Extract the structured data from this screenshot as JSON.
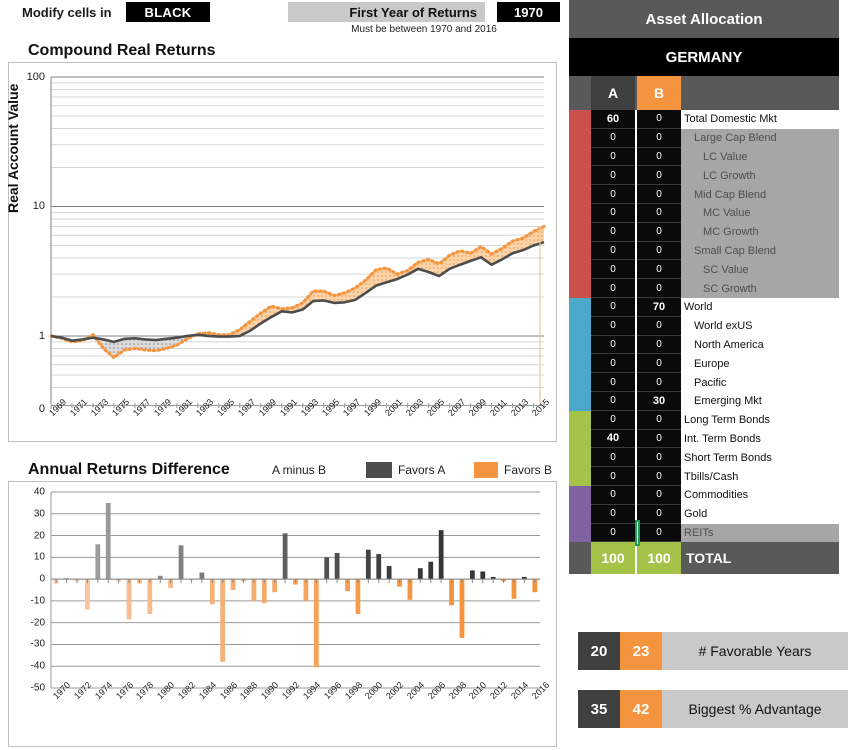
{
  "controls": {
    "modify_label": "Modify cells in",
    "modify_chip": "BLACK",
    "first_year_label": "First Year of Returns",
    "first_year_value": "1970",
    "note": "Must be between 1970 and 2016"
  },
  "charts": {
    "top": {
      "title": "Compound Real Returns",
      "ylabel": "Real Account Value"
    },
    "bottom": {
      "title": "Annual Returns Difference",
      "legend": {
        "series_label": "A minus B",
        "favors_a": "Favors A",
        "favors_b": "Favors B",
        "color_a": "#4d4d4d",
        "color_b": "#f5943e"
      }
    }
  },
  "chart_data": [
    {
      "type": "line",
      "title": "Compound Real Returns",
      "xlabel": "",
      "ylabel": "Real Account Value",
      "yscale": "log",
      "ylim": [
        0.35,
        100
      ],
      "yticks": [
        0,
        1,
        10,
        100
      ],
      "ytick_labels": [
        "0",
        "1",
        "10",
        "100"
      ],
      "grid": true,
      "legend_position": "none",
      "x": [
        1969,
        1970,
        1971,
        1972,
        1973,
        1974,
        1975,
        1976,
        1977,
        1978,
        1979,
        1980,
        1981,
        1982,
        1983,
        1984,
        1985,
        1986,
        1987,
        1988,
        1989,
        1990,
        1991,
        1992,
        1993,
        1994,
        1995,
        1996,
        1997,
        1998,
        1999,
        2000,
        2001,
        2002,
        2003,
        2004,
        2005,
        2006,
        2007,
        2008,
        2009,
        2010,
        2011,
        2012,
        2013,
        2014,
        2015,
        2016
      ],
      "series": [
        {
          "name": "A",
          "color": "#4d4d4d",
          "style": "solid",
          "values": [
            1.0,
            0.97,
            0.92,
            0.94,
            0.97,
            0.94,
            0.9,
            0.95,
            0.96,
            0.94,
            0.93,
            0.95,
            0.97,
            1.0,
            1.02,
            1.0,
            0.99,
            0.99,
            1.0,
            1.1,
            1.25,
            1.4,
            1.55,
            1.52,
            1.6,
            1.86,
            1.88,
            1.8,
            1.82,
            1.9,
            2.15,
            2.45,
            2.6,
            2.75,
            2.98,
            3.3,
            3.12,
            2.9,
            3.3,
            3.55,
            3.8,
            4.05,
            3.55,
            3.9,
            4.35,
            4.6,
            5.0,
            5.3
          ]
        },
        {
          "name": "B",
          "color": "#f5943e",
          "style": "dotted",
          "values": [
            1.0,
            0.96,
            0.9,
            0.92,
            1.02,
            0.8,
            0.68,
            0.78,
            0.8,
            0.78,
            0.77,
            0.8,
            0.85,
            0.95,
            1.04,
            1.06,
            1.02,
            1.02,
            1.12,
            1.3,
            1.5,
            1.7,
            1.62,
            1.65,
            1.8,
            2.22,
            2.22,
            2.05,
            2.15,
            2.35,
            2.7,
            3.25,
            3.35,
            3.0,
            3.2,
            3.7,
            3.9,
            3.6,
            4.2,
            4.55,
            4.35,
            4.9,
            4.3,
            4.75,
            5.4,
            5.7,
            6.4,
            7.0
          ]
        }
      ],
      "xticks": [
        1969,
        1971,
        1973,
        1975,
        1977,
        1979,
        1981,
        1983,
        1985,
        1987,
        1989,
        1991,
        1993,
        1995,
        1997,
        1999,
        2001,
        2003,
        2005,
        2007,
        2009,
        2011,
        2013,
        2015
      ]
    },
    {
      "type": "bar",
      "title": "Annual Returns Difference",
      "xlabel": "",
      "ylabel": "",
      "ylim": [
        -50,
        40
      ],
      "yticks": [
        40,
        30,
        20,
        10,
        0,
        -10,
        -20,
        -30,
        -40,
        -50
      ],
      "grid": true,
      "legend_position": "top-right",
      "series_name": "A minus B",
      "categories": [
        1970,
        1971,
        1972,
        1973,
        1974,
        1975,
        1976,
        1977,
        1978,
        1979,
        1980,
        1981,
        1982,
        1983,
        1984,
        1985,
        1986,
        1987,
        1988,
        1989,
        1990,
        1991,
        1992,
        1993,
        1994,
        1995,
        1996,
        1997,
        1998,
        1999,
        2000,
        2001,
        2002,
        2003,
        2004,
        2005,
        2006,
        2007,
        2008,
        2009,
        2010,
        2011,
        2012,
        2013,
        2014,
        2015,
        2016
      ],
      "values": [
        -2,
        0.5,
        -1,
        -14,
        16,
        35,
        -1,
        -18.5,
        -2,
        -16,
        1.5,
        -4,
        15.5,
        -0.5,
        3,
        -11.5,
        -38,
        -5,
        -1,
        -10,
        -11,
        -6,
        21,
        -2.5,
        -10,
        -40.5,
        10,
        12,
        -5.5,
        -16,
        13.5,
        11.5,
        6,
        -3.5,
        -9.5,
        5,
        8,
        22.5,
        -12,
        -27,
        4,
        3.5,
        1,
        -1,
        -9,
        1,
        -6
      ],
      "xticks": [
        1970,
        1972,
        1974,
        1976,
        1978,
        1980,
        1982,
        1984,
        1986,
        1988,
        1990,
        1992,
        1994,
        1996,
        1998,
        2000,
        2002,
        2004,
        2006,
        2008,
        2010,
        2012,
        2014,
        2016
      ]
    }
  ],
  "allocation": {
    "title": "Asset Allocation",
    "country": "GERMANY",
    "col_a": "A",
    "col_b": "B",
    "rows": [
      {
        "a": "60",
        "b": "0",
        "label": "Total Domestic Mkt",
        "indent": 0,
        "shade": "white",
        "strip": "#c9504d"
      },
      {
        "a": "0",
        "b": "0",
        "label": "Large Cap Blend",
        "indent": 1,
        "shade": "shade",
        "strip": "#c9504d"
      },
      {
        "a": "0",
        "b": "0",
        "label": "LC Value",
        "indent": 2,
        "shade": "shade",
        "strip": "#c9504d"
      },
      {
        "a": "0",
        "b": "0",
        "label": "LC Growth",
        "indent": 2,
        "shade": "shade",
        "strip": "#c9504d"
      },
      {
        "a": "0",
        "b": "0",
        "label": "Mid Cap Blend",
        "indent": 1,
        "shade": "shade",
        "strip": "#c9504d"
      },
      {
        "a": "0",
        "b": "0",
        "label": "MC Value",
        "indent": 2,
        "shade": "shade",
        "strip": "#c9504d"
      },
      {
        "a": "0",
        "b": "0",
        "label": "MC Growth",
        "indent": 2,
        "shade": "shade",
        "strip": "#c9504d"
      },
      {
        "a": "0",
        "b": "0",
        "label": "Small Cap Blend",
        "indent": 1,
        "shade": "shade",
        "strip": "#c9504d"
      },
      {
        "a": "0",
        "b": "0",
        "label": "SC Value",
        "indent": 2,
        "shade": "shade",
        "strip": "#c9504d"
      },
      {
        "a": "0",
        "b": "0",
        "label": "SC Growth",
        "indent": 2,
        "shade": "shade",
        "strip": "#c9504d"
      },
      {
        "a": "0",
        "b": "70",
        "label": "World",
        "indent": 0,
        "shade": "white",
        "strip": "#4ba8c9"
      },
      {
        "a": "0",
        "b": "0",
        "label": "World exUS",
        "indent": 1,
        "shade": "white",
        "strip": "#4ba8c9"
      },
      {
        "a": "0",
        "b": "0",
        "label": "North America",
        "indent": 1,
        "shade": "white",
        "strip": "#4ba8c9"
      },
      {
        "a": "0",
        "b": "0",
        "label": "Europe",
        "indent": 1,
        "shade": "white",
        "strip": "#4ba8c9"
      },
      {
        "a": "0",
        "b": "0",
        "label": "Pacific",
        "indent": 1,
        "shade": "white",
        "strip": "#4ba8c9"
      },
      {
        "a": "0",
        "b": "30",
        "label": "Emerging Mkt",
        "indent": 1,
        "shade": "white",
        "strip": "#4ba8c9"
      },
      {
        "a": "0",
        "b": "0",
        "label": "Long Term Bonds",
        "indent": 0,
        "shade": "white",
        "strip": "#a5c249"
      },
      {
        "a": "40",
        "b": "0",
        "label": "Int. Term Bonds",
        "indent": 0,
        "shade": "white",
        "strip": "#a5c249"
      },
      {
        "a": "0",
        "b": "0",
        "label": "Short Term Bonds",
        "indent": 0,
        "shade": "white",
        "strip": "#a5c249"
      },
      {
        "a": "0",
        "b": "0",
        "label": "Tbills/Cash",
        "indent": 0,
        "shade": "white",
        "strip": "#a5c249"
      },
      {
        "a": "0",
        "b": "0",
        "label": "Commodities",
        "indent": 0,
        "shade": "white",
        "strip": "#8064a2"
      },
      {
        "a": "0",
        "b": "0",
        "label": "Gold",
        "indent": 0,
        "shade": "white",
        "strip": "#8064a2"
      },
      {
        "a": "0",
        "b": "0",
        "label": "REITs",
        "indent": 0,
        "shade": "shade",
        "strip": "#8064a2"
      }
    ],
    "total": {
      "a": "100",
      "b": "100",
      "label": "TOTAL"
    }
  },
  "stats": [
    {
      "a": "20",
      "b": "23",
      "label": "# Favorable Years"
    },
    {
      "a": "35",
      "b": "42",
      "label": "Biggest % Advantage"
    }
  ]
}
